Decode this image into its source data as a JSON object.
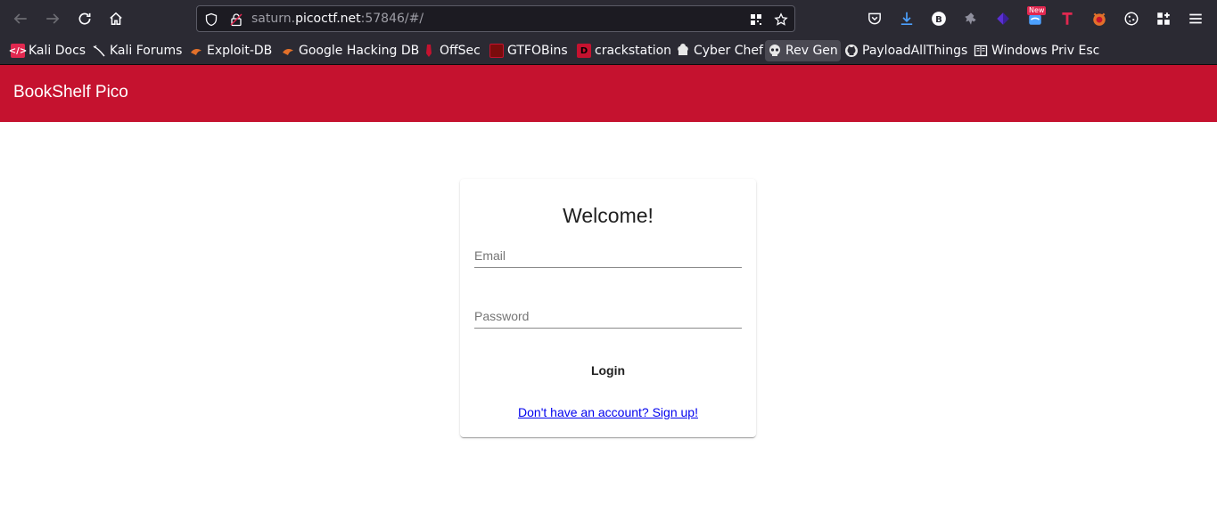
{
  "browser": {
    "url_prefix": "saturn.",
    "url_domain": "picoctf.net",
    "url_suffix": ":57846/#/",
    "new_badge": "New"
  },
  "bookmarks": [
    {
      "label": "Kali Docs",
      "icon": "kali-docs-icon"
    },
    {
      "label": "Kali Forums",
      "icon": "kali-forums-icon"
    },
    {
      "label": "Exploit-DB",
      "icon": "exploit-db-icon"
    },
    {
      "label": "Google Hacking DB",
      "icon": "ghdb-icon"
    },
    {
      "label": "OffSec",
      "icon": "offsec-icon"
    },
    {
      "label": "GTFOBins",
      "icon": "gtfobins-icon"
    },
    {
      "label": "crackstation",
      "icon": "crackstation-icon"
    },
    {
      "label": "Cyber Chef",
      "icon": "cyberchef-icon"
    },
    {
      "label": "Rev Gen",
      "icon": "skull-icon"
    },
    {
      "label": "PayloadAllThings",
      "icon": "github-icon"
    },
    {
      "label": "Windows Priv Esc",
      "icon": "book-icon"
    }
  ],
  "app": {
    "title": "BookShelf Pico",
    "brand_color": "#c5122f"
  },
  "login": {
    "heading": "Welcome!",
    "email_placeholder": "Email",
    "password_placeholder": "Password",
    "login_label": "Login",
    "signup_link": "Don't have an account? Sign up!"
  }
}
